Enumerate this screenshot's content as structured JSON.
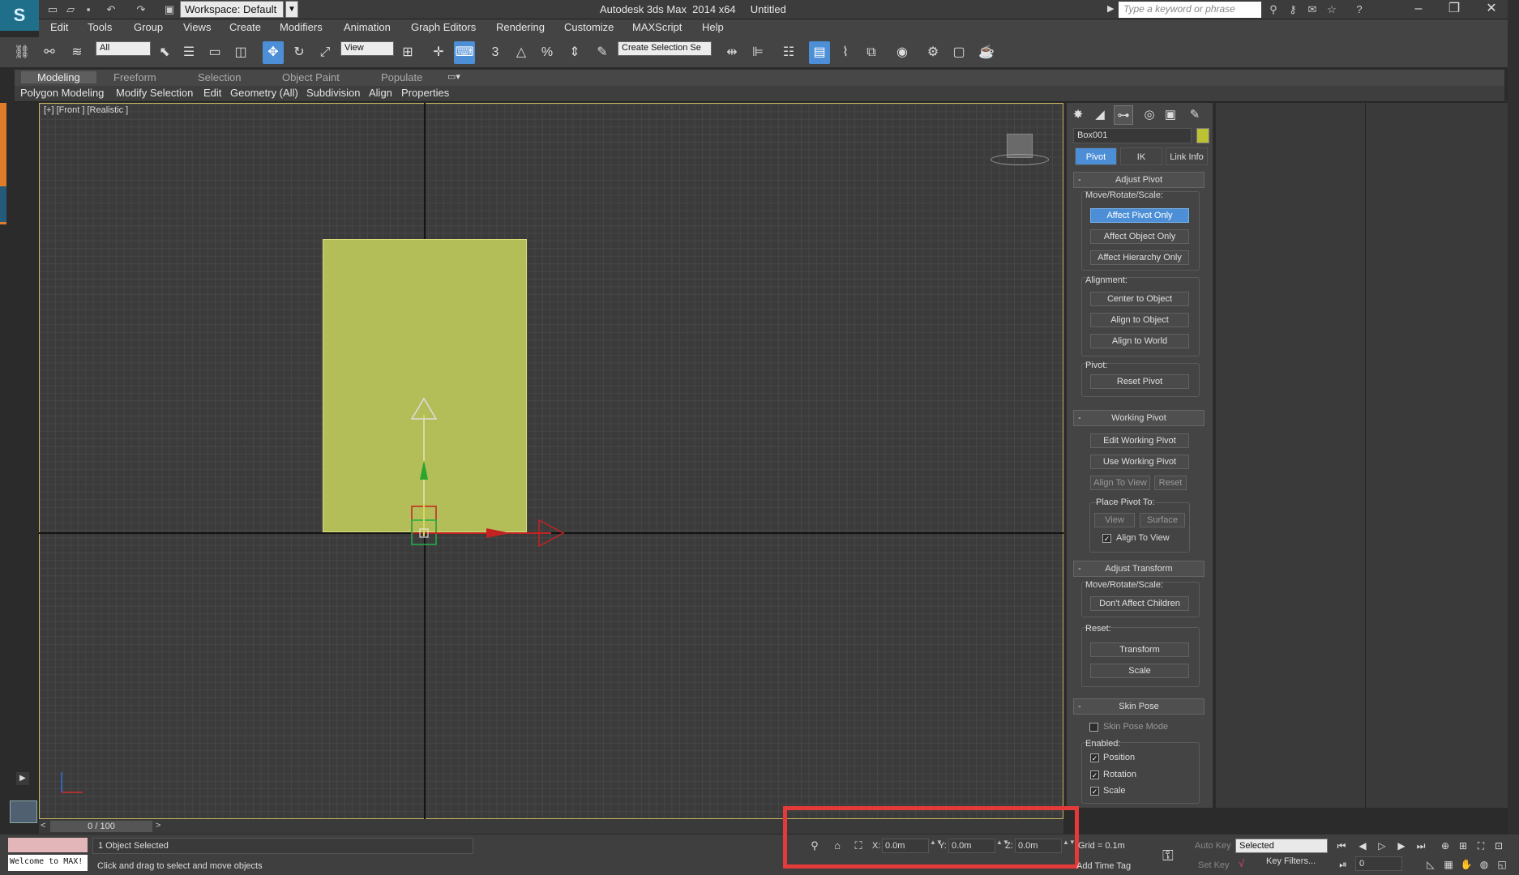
{
  "titlebar": {
    "workspace": "Workspace: Default",
    "app_title": "Autodesk 3ds Max  2014 x64     Untitled",
    "search_placeholder": "Type a keyword or phrase"
  },
  "menu": [
    "Edit",
    "Tools",
    "Group",
    "Views",
    "Create",
    "Modifiers",
    "Animation",
    "Graph Editors",
    "Rendering",
    "Customize",
    "MAXScript",
    "Help"
  ],
  "toolbar": {
    "filter_value": "All",
    "ref_coord_value": "View",
    "selection_set_placeholder": "Create Selection Se",
    "snap_3d": "3",
    "angle_snap": "△",
    "percent_snap": "%"
  },
  "ribbon": {
    "tabs": [
      "Modeling",
      "Freeform",
      "Selection",
      "Object Paint",
      "Populate"
    ],
    "subtabs": [
      "Polygon Modeling",
      "Modify Selection",
      "Edit",
      "Geometry (All)",
      "Subdivision",
      "Align",
      "Properties"
    ]
  },
  "viewport": {
    "label": "[+] [Front ] [Realistic ]"
  },
  "command_panel": {
    "object_name": "Box001",
    "object_color": "#bbc335",
    "hierarchy_tabs": [
      "Pivot",
      "IK",
      "Link Info"
    ],
    "adjust_pivot": {
      "title": "Adjust Pivot",
      "move_label": "Move/Rotate/Scale:",
      "buttons": [
        "Affect Pivot Only",
        "Affect Object Only",
        "Affect Hierarchy Only"
      ],
      "alignment_label": "Alignment:",
      "align_buttons": [
        "Center to Object",
        "Align to Object",
        "Align to World"
      ],
      "pivot_label": "Pivot:",
      "reset_pivot": "Reset Pivot"
    },
    "working_pivot": {
      "title": "Working Pivot",
      "edit": "Edit Working Pivot",
      "use": "Use Working Pivot",
      "align_to_view": "Align To View",
      "reset": "Reset",
      "place_label": "Place Pivot To:",
      "view": "View",
      "surface": "Surface",
      "align_check": "Align To View"
    },
    "adjust_transform": {
      "title": "Adjust Transform",
      "move_label": "Move/Rotate/Scale:",
      "dont_affect": "Don't Affect Children",
      "reset_label": "Reset:",
      "transform": "Transform",
      "scale": "Scale"
    },
    "skin_pose": {
      "title": "Skin Pose",
      "mode": "Skin Pose Mode",
      "enabled_label": "Enabled:",
      "position": "Position",
      "rotation": "Rotation",
      "scale": "Scale"
    },
    "rollout_toggle": "-"
  },
  "timeline": {
    "frame_display": "0 / 100",
    "prev": "<",
    "next": ">"
  },
  "status": {
    "welcome": "Welcome to MAX!",
    "selection": "1 Object Selected",
    "prompt": "Click and drag to select and move objects",
    "x_label": "X:",
    "y_label": "Y:",
    "z_label": "Z:",
    "x": "0.0m",
    "y": "0.0m",
    "z": "0.0m",
    "grid": "Grid = 0.1m",
    "add_time_tag": "Add Time Tag",
    "auto_key": "Auto Key",
    "set_key": "Set Key",
    "selected_dd": "Selected",
    "key_filters": "Key Filters...",
    "frame": "0"
  }
}
